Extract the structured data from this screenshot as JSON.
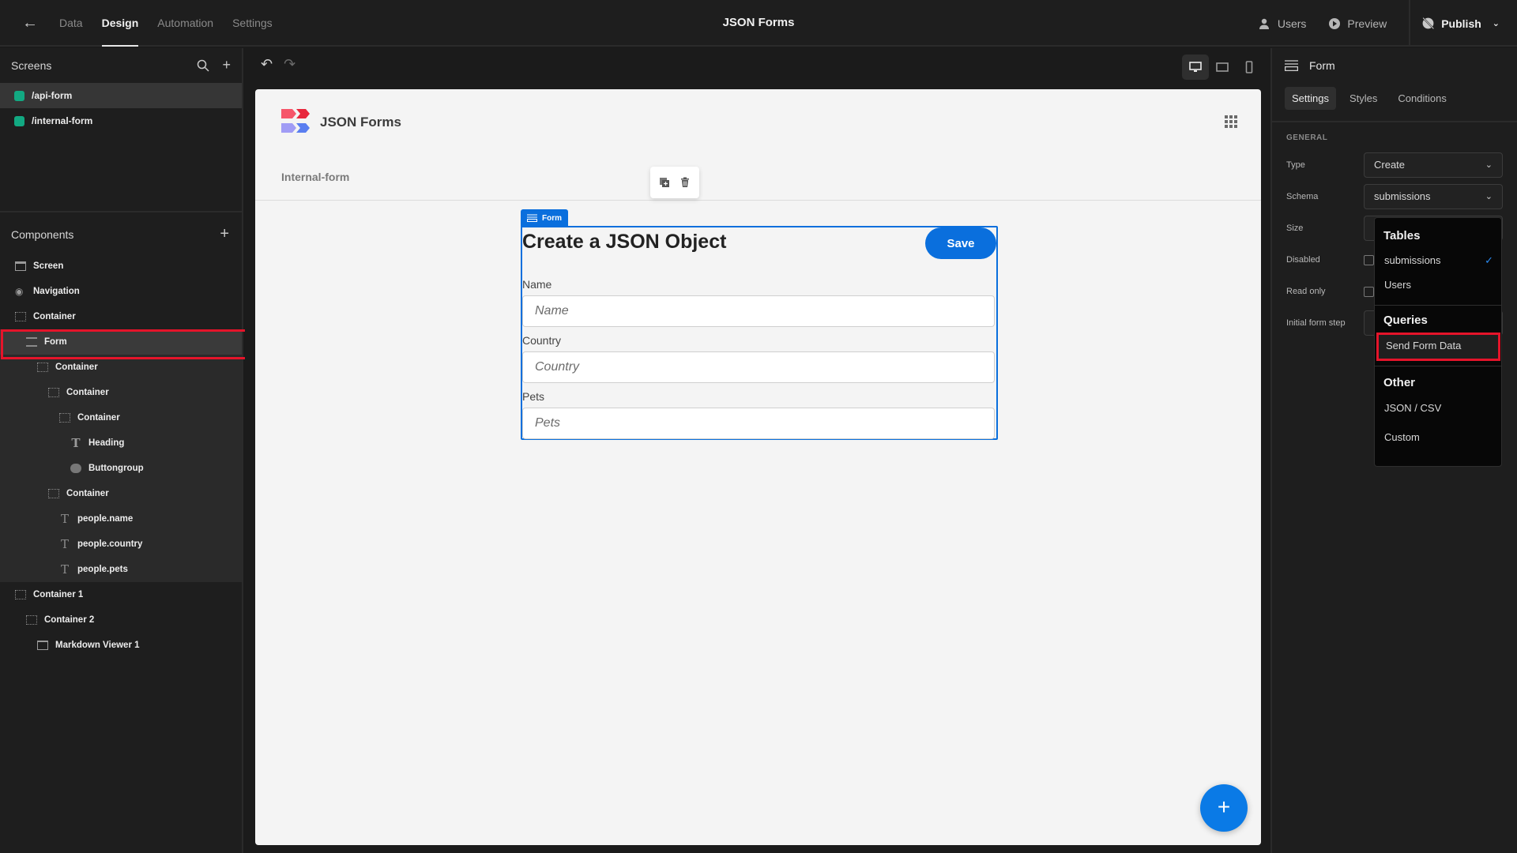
{
  "topbar": {
    "back_label": "←",
    "tabs": [
      {
        "label": "Data",
        "active": false
      },
      {
        "label": "Design",
        "active": true
      },
      {
        "label": "Automation",
        "active": false
      },
      {
        "label": "Settings",
        "active": false
      }
    ],
    "app_title": "JSON Forms",
    "users_label": "Users",
    "preview_label": "Preview",
    "publish_label": "Publish"
  },
  "screens": {
    "title": "Screens",
    "items": [
      {
        "label": "/api-form",
        "selected": true
      },
      {
        "label": "/internal-form",
        "selected": false
      }
    ]
  },
  "components": {
    "title": "Components",
    "tree": [
      {
        "label": "Screen",
        "icon": "screen-icon"
      },
      {
        "label": "Navigation",
        "icon": "eye-icon"
      },
      {
        "label": "Container",
        "icon": "container-icon"
      },
      {
        "label": "Form",
        "icon": "form-icon",
        "selected": true
      },
      {
        "label": "Container",
        "icon": "container-icon"
      },
      {
        "label": "Container",
        "icon": "container-icon"
      },
      {
        "label": "Container",
        "icon": "container-icon"
      },
      {
        "label": "Heading",
        "icon": "heading-icon"
      },
      {
        "label": "Buttongroup",
        "icon": "buttongroup-icon"
      },
      {
        "label": "Container",
        "icon": "container-icon"
      },
      {
        "label": "people.name",
        "icon": "text-icon"
      },
      {
        "label": "people.country",
        "icon": "text-icon"
      },
      {
        "label": "people.pets",
        "icon": "text-icon"
      },
      {
        "label": "Container 1",
        "icon": "container-icon"
      },
      {
        "label": "Container 2",
        "icon": "container-icon"
      },
      {
        "label": "Markdown Viewer 1",
        "icon": "markdown-viewer-icon"
      }
    ]
  },
  "canvas": {
    "device": "desktop",
    "brand": "JSON Forms",
    "subnav": "Internal-form",
    "form_tag": "Form",
    "form": {
      "title": "Create a JSON Object",
      "save_label": "Save",
      "fields": [
        {
          "label": "Name",
          "placeholder": "Name"
        },
        {
          "label": "Country",
          "placeholder": "Country"
        },
        {
          "label": "Pets",
          "placeholder": "Pets"
        }
      ]
    },
    "fab_label": "+"
  },
  "settings": {
    "component_name": "Form",
    "tabs": [
      {
        "label": "Settings",
        "active": true
      },
      {
        "label": "Styles",
        "active": false
      },
      {
        "label": "Conditions",
        "active": false
      }
    ],
    "section": "GENERAL",
    "props": {
      "type_label": "Type",
      "type_value": "Create",
      "schema_label": "Schema",
      "schema_value": "submissions",
      "size_label": "Size",
      "disabled_label": "Disabled",
      "readonly_label": "Read only",
      "initial_step_label": "Initial form step"
    },
    "dropdown": {
      "tables_heading": "Tables",
      "tables": [
        "submissions",
        "Users"
      ],
      "selected": "submissions",
      "queries_heading": "Queries",
      "queries": [
        "Send Form Data"
      ],
      "other_heading": "Other",
      "other": [
        "JSON / CSV",
        "Custom"
      ]
    }
  },
  "colors": {
    "accent": "#0a6fdd",
    "screen_dot": "#12a982",
    "highlight": "#e5142a"
  }
}
